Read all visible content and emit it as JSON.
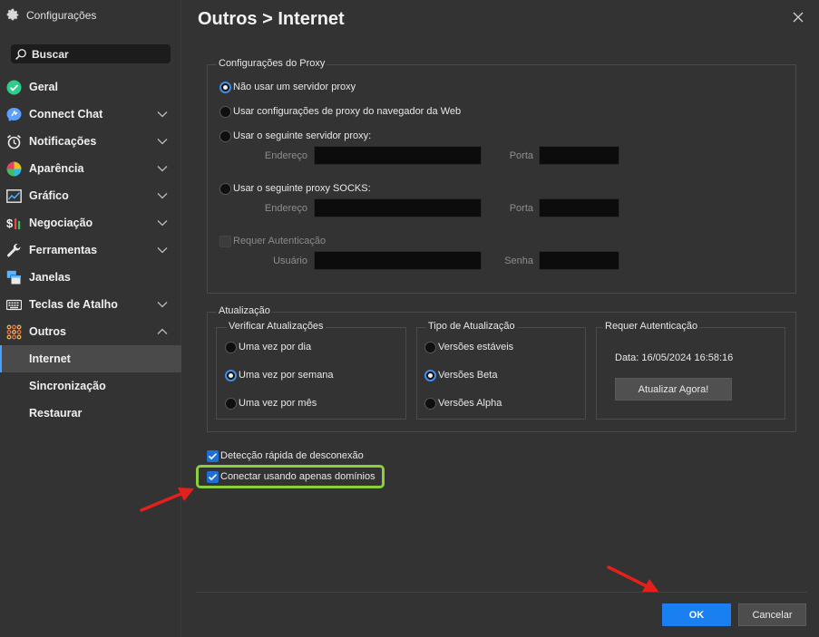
{
  "window": {
    "title": "Configurações"
  },
  "search": {
    "placeholder": "Buscar"
  },
  "sidebar": {
    "items": [
      {
        "label": "Geral",
        "icon": "check-circle-icon",
        "chevron": false
      },
      {
        "label": "Connect Chat",
        "icon": "chat-bubble-icon",
        "chevron": true
      },
      {
        "label": "Notificações",
        "icon": "alarm-clock-icon",
        "chevron": true
      },
      {
        "label": "Aparência",
        "icon": "color-wheel-icon",
        "chevron": true
      },
      {
        "label": "Gráfico",
        "icon": "line-chart-icon",
        "chevron": true
      },
      {
        "label": "Negociação",
        "icon": "dollar-bars-icon",
        "chevron": true
      },
      {
        "label": "Ferramentas",
        "icon": "wrench-icon",
        "chevron": true
      },
      {
        "label": "Janelas",
        "icon": "windows-icon",
        "chevron": false
      },
      {
        "label": "Teclas de Atalho",
        "icon": "keyboard-icon",
        "chevron": true
      },
      {
        "label": "Outros",
        "icon": "dots-grid-icon",
        "chevron": "up"
      },
      {
        "label": "Internet",
        "selected": true
      },
      {
        "label": "Sincronização"
      },
      {
        "label": "Restaurar"
      }
    ]
  },
  "page": {
    "title": "Outros > Internet"
  },
  "proxy": {
    "title": "Configurações do Proxy",
    "opt_none": "Não usar um servidor proxy",
    "opt_browser": "Usar configurações de proxy do navegador da Web",
    "opt_server": "Usar o seguinte servidor proxy:",
    "opt_socks": "Usar o seguinte proxy SOCKS:",
    "address_label": "Endereço",
    "port_label": "Porta",
    "auth_label": "Requer Autenticação",
    "user_label": "Usuário",
    "password_label": "Senha",
    "selected": "none"
  },
  "update": {
    "title": "Atualização",
    "check": {
      "title": "Verificar Atualizações",
      "options": [
        "Uma vez por dia",
        "Uma vez por semana",
        "Uma vez por mês"
      ],
      "selected_index": 1
    },
    "type": {
      "title": "Tipo de Atualização",
      "options": [
        "Versões estáveis",
        "Versões Beta",
        "Versões Alpha"
      ],
      "selected_index": 1
    },
    "auth": {
      "title": "Requer Autenticação",
      "date_text": "Data: 16/05/2024 16:58:16",
      "button": "Atualizar Agora!"
    }
  },
  "options": {
    "fast_disconnect": "Detecção rápida de desconexão",
    "domains_only": "Conectar usando apenas domínios"
  },
  "footer": {
    "ok": "OK",
    "cancel": "Cancelar"
  },
  "colors": {
    "accent": "#1a7ff0",
    "highlight": "#8ccf3c",
    "arrow": "#e3201b"
  }
}
